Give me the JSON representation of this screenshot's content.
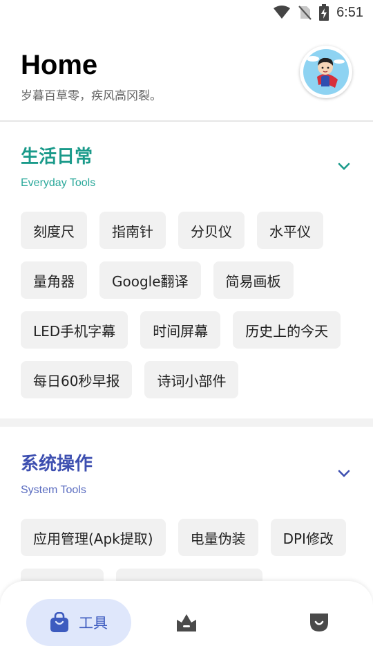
{
  "status_bar": {
    "time": "6:51",
    "icons": [
      "wifi-icon",
      "no-sim-icon",
      "battery-charging-icon"
    ]
  },
  "header": {
    "title": "Home",
    "subtitle": "岁暮百草零，疾风高冈裂。"
  },
  "sections": [
    {
      "title": "生活日常",
      "subtitle": "Everyday Tools",
      "color": "#1a9a8a",
      "items": [
        "刻度尺",
        "指南针",
        "分贝仪",
        "水平仪",
        "量角器",
        "Google翻译",
        "简易画板",
        "LED手机字幕",
        "时间屏幕",
        "历史上的今天",
        "每日60秒早报",
        "诗词小部件"
      ]
    },
    {
      "title": "系统操作",
      "subtitle": "System Tools",
      "color": "#3d4fb0",
      "items": [
        "应用管理(Apk提取)",
        "电量伪装",
        "DPI修改"
      ]
    }
  ],
  "bottom_nav": {
    "items": [
      {
        "label": "工具",
        "icon": "toolbox-icon",
        "active": true
      },
      {
        "label": "",
        "icon": "crown-icon",
        "active": false
      },
      {
        "label": "",
        "icon": "shield-icon",
        "active": false
      }
    ],
    "active_bg": "#dfe7fb",
    "active_color": "#3d5bbf",
    "inactive_color": "#4a4a4a"
  }
}
